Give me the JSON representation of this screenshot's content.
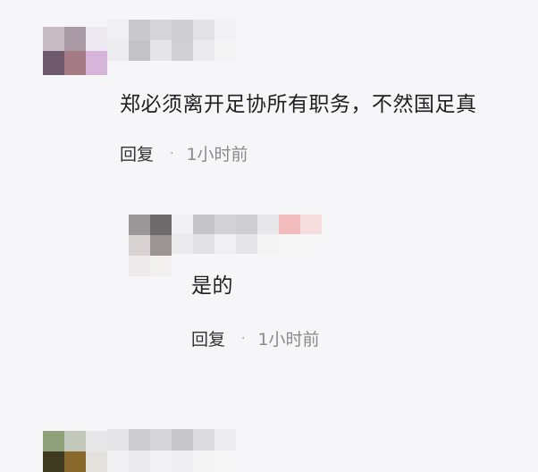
{
  "comments": [
    {
      "text": "郑必须离开足协所有职务，不然国足真",
      "reply_label": "回复",
      "separator": "·",
      "time": "1小时前"
    }
  ],
  "replies": [
    {
      "text": "是的",
      "reply_label": "回复",
      "separator": "·",
      "time": "1小时前"
    }
  ]
}
